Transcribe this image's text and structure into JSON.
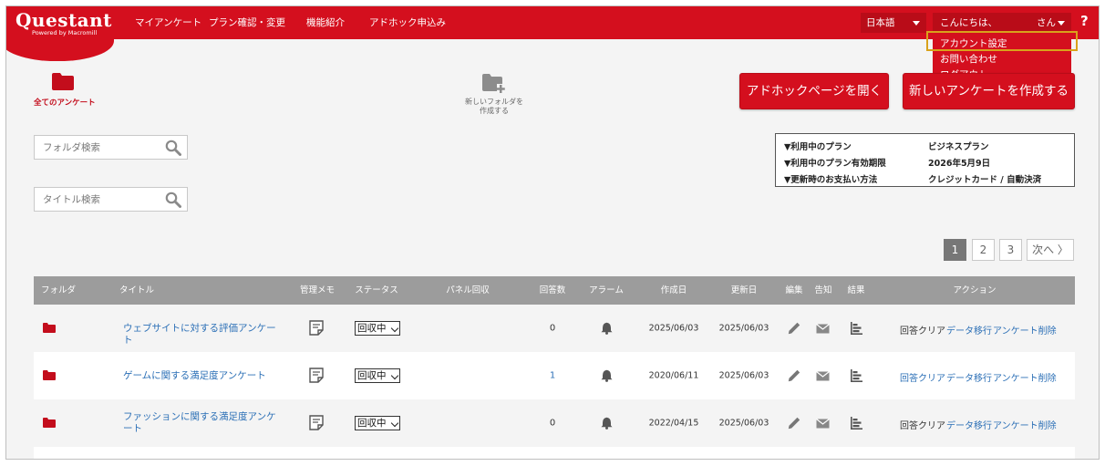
{
  "header": {
    "logo": "Questant",
    "logo_sub": "Powered by Macromill",
    "nav": [
      "マイアンケート",
      "プラン確認・変更",
      "機能紹介",
      "アドホック申込み"
    ],
    "language": "日本語",
    "greeting": "こんにちは、",
    "greeting_suffix": "さん",
    "help": "?"
  },
  "user_menu": {
    "items": [
      "アカウント設定",
      "お問い合わせ",
      "ログアウト"
    ],
    "highlighted": "アカウント設定",
    "highlight_color": "#d9a21b"
  },
  "folders": {
    "all_label": "全てのアンケート",
    "new_label_line1": "新しいフォルダを",
    "new_label_line2": "作成する"
  },
  "buttons": {
    "adhoc": "アドホックページを開く",
    "new_survey": "新しいアンケートを作成する"
  },
  "search": {
    "folder_placeholder": "フォルダ検索",
    "title_placeholder": "タイトル検索"
  },
  "plan": {
    "rows": [
      {
        "label": "▼利用中のプラン",
        "value": "ビジネスプラン"
      },
      {
        "label": "▼利用中のプラン有効期限",
        "value": "2026年5月9日"
      },
      {
        "label": "▼更新時のお支払い方法",
        "value": "クレジットカード / 自動決済"
      }
    ]
  },
  "pagination": {
    "pages": [
      "1",
      "2",
      "3"
    ],
    "current": "1",
    "next": "次へ 〉"
  },
  "table": {
    "columns": [
      "フォルダ",
      "タイトル",
      "管理メモ",
      "ステータス",
      "パネル回収",
      "回答数",
      "アラーム",
      "作成日",
      "更新日",
      "編集",
      "告知",
      "結果",
      "アクション"
    ],
    "rows": [
      {
        "title": "ウェブサイトに対する評価アンケート",
        "status": "回収中",
        "responses": "0",
        "created": "2025/06/03",
        "updated": "2025/06/03",
        "actions": [
          "回答クリア",
          "データ移行",
          "アンケート削除"
        ],
        "clear_is_link": false
      },
      {
        "title": "ゲームに関する満足度アンケート",
        "status": "回収中",
        "responses": "1",
        "created": "2020/06/11",
        "updated": "2025/06/03",
        "actions": [
          "回答クリア",
          "データ移行",
          "アンケート削除"
        ],
        "clear_is_link": true
      },
      {
        "title": "ファッションに関する満足度アンケート",
        "status": "回収中",
        "responses": "0",
        "created": "2022/04/15",
        "updated": "2025/06/03",
        "actions": [
          "回答クリア",
          "データ移行",
          "アンケート削除"
        ],
        "clear_is_link": false
      }
    ]
  },
  "colors": {
    "brand_red": "#d40f1e",
    "link_blue": "#2b6fb6",
    "header_gray": "#9c9c9c"
  },
  "icons": {
    "folder": "folder-icon",
    "new_folder": "folder-plus-icon",
    "search": "search-icon",
    "memo": "memo-icon",
    "alarm": "bell-icon",
    "edit": "pencil-icon",
    "notify": "envelope-icon",
    "result": "bar-chart-icon"
  }
}
